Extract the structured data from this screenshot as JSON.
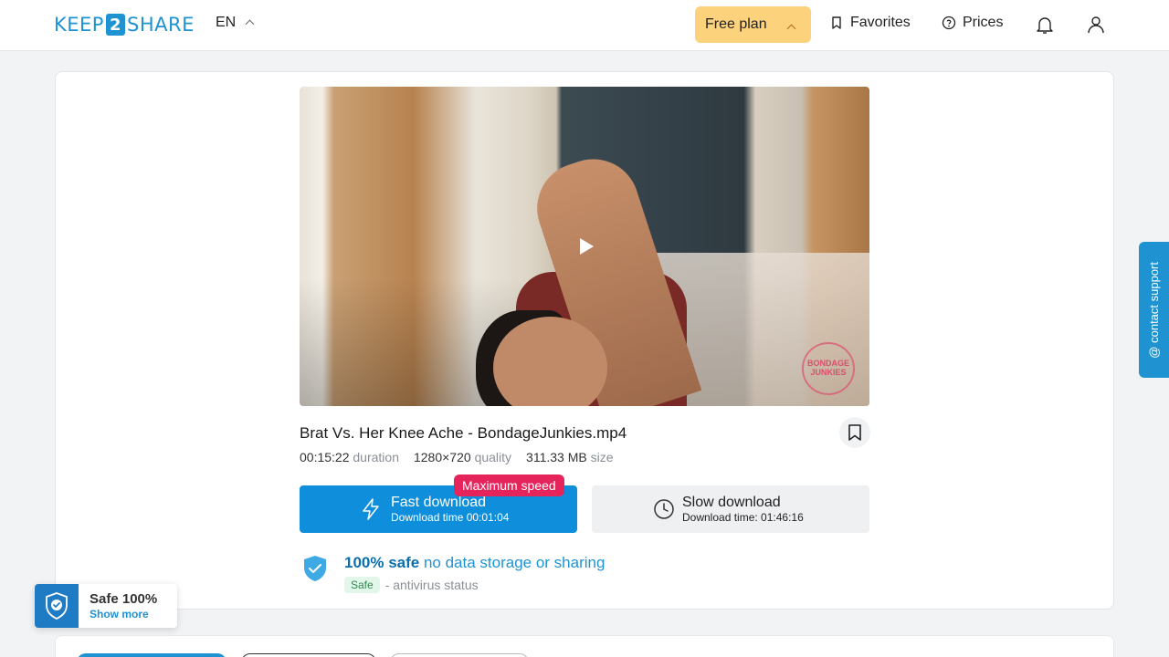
{
  "header": {
    "logo_left": "KEEP",
    "logo_num": "2",
    "logo_right": "SHARE",
    "lang": "EN",
    "plan_label": "Free plan",
    "favorites_label": "Favorites",
    "prices_label": "Prices"
  },
  "file": {
    "name": "Brat Vs. Her Knee Ache - BondageJunkies.mp4",
    "duration_value": "00:15:22",
    "duration_label": "duration",
    "quality_value": "1280×720",
    "quality_label": "quality",
    "size_value": "311.33 MB",
    "size_label": "size",
    "watermark": "BONDAGE JUNKIES"
  },
  "download": {
    "badge": "Maximum speed",
    "fast_title": "Fast download",
    "fast_sub": "Download time 00:01:04",
    "slow_title": "Slow download",
    "slow_sub": "Download time: 01:46:16"
  },
  "safety": {
    "headline_bold": "100% safe",
    "headline_rest": " no data storage or sharing",
    "status_pill": "Safe",
    "status_text": "- antivirus status"
  },
  "support": {
    "label": "@ contact support"
  },
  "widget": {
    "title": "Safe 100%",
    "link": "Show more"
  },
  "colors": {
    "accent": "#1f93d2",
    "badge": "#e5245b",
    "plan": "#fdd27c"
  }
}
